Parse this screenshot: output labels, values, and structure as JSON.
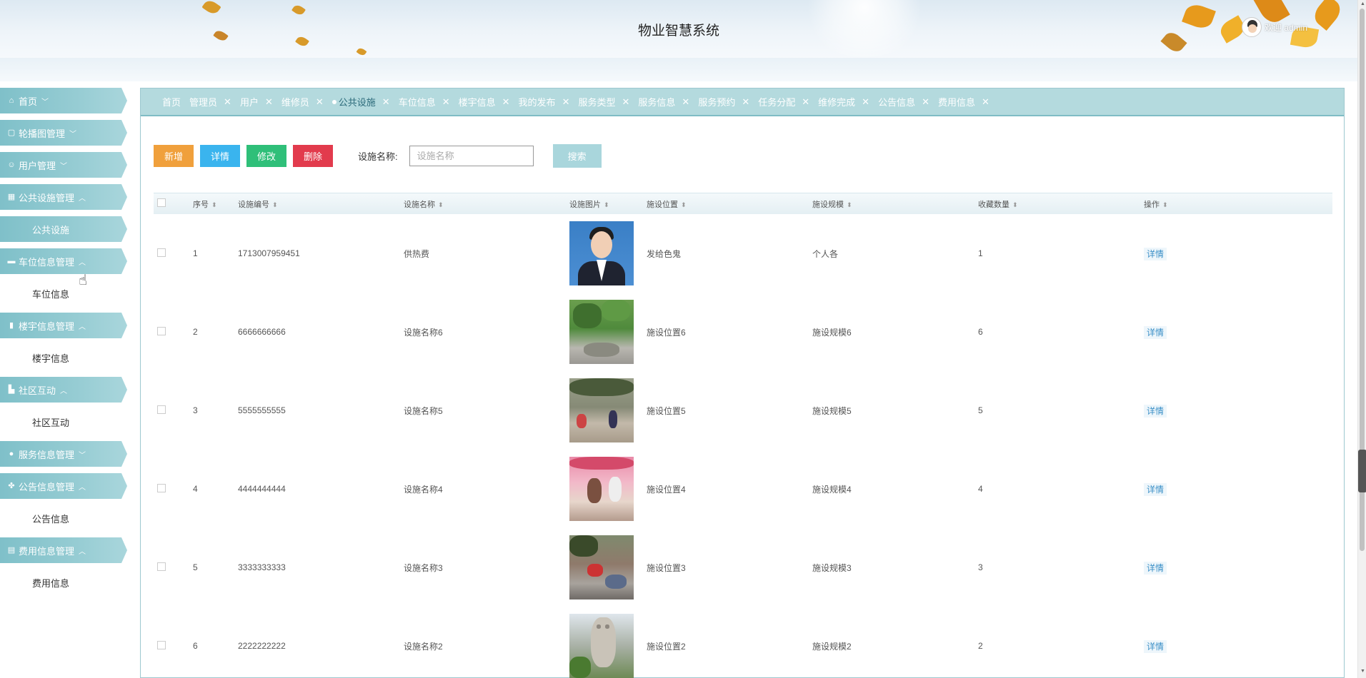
{
  "header": {
    "title": "物业智慧系统",
    "welcome": "欢迎 admin"
  },
  "sidebar": {
    "items": [
      {
        "label": "首页",
        "icon": "home-icon",
        "glyph": "⌂",
        "chevron": "﹀",
        "active": false
      },
      {
        "label": "轮播图管理",
        "icon": "image-icon",
        "glyph": "▢",
        "chevron": "﹀",
        "active": false
      },
      {
        "label": "用户管理",
        "icon": "user-icon",
        "glyph": "☺",
        "chevron": "﹀",
        "active": false
      },
      {
        "label": "公共设施管理",
        "icon": "grid-icon",
        "glyph": "▦",
        "chevron": "︿",
        "active": false,
        "sub": "公共设施",
        "subActive": true
      },
      {
        "label": "车位信息管理",
        "icon": "car-icon",
        "glyph": "▬",
        "chevron": "︿",
        "active": false,
        "sub": "车位信息",
        "subActive": false
      },
      {
        "label": "楼宇信息管理",
        "icon": "building-icon",
        "glyph": "▮",
        "chevron": "︿",
        "active": false,
        "sub": "楼宇信息",
        "subActive": false
      },
      {
        "label": "社区互动",
        "icon": "community-icon",
        "glyph": "▙",
        "chevron": "︿",
        "active": false,
        "sub": "社区互动",
        "subActive": false
      },
      {
        "label": "服务信息管理",
        "icon": "service-icon",
        "glyph": "●",
        "chevron": "﹀",
        "active": false
      },
      {
        "label": "公告信息管理",
        "icon": "apps-icon",
        "glyph": "✤",
        "chevron": "︿",
        "active": false,
        "sub": "公告信息",
        "subActive": false
      },
      {
        "label": "费用信息管理",
        "icon": "fee-icon",
        "glyph": "▤",
        "chevron": "︿",
        "active": false,
        "sub": "费用信息",
        "subActive": false
      }
    ]
  },
  "tabs": [
    {
      "label": "首页",
      "closable": false,
      "active": false
    },
    {
      "label": "管理员",
      "closable": true,
      "active": false
    },
    {
      "label": "用户",
      "closable": true,
      "active": false
    },
    {
      "label": "维修员",
      "closable": true,
      "active": false
    },
    {
      "label": "公共设施",
      "closable": true,
      "active": true
    },
    {
      "label": "车位信息",
      "closable": true,
      "active": false
    },
    {
      "label": "楼宇信息",
      "closable": true,
      "active": false
    },
    {
      "label": "我的发布",
      "closable": true,
      "active": false
    },
    {
      "label": "服务类型",
      "closable": true,
      "active": false
    },
    {
      "label": "服务信息",
      "closable": true,
      "active": false
    },
    {
      "label": "服务预约",
      "closable": true,
      "active": false
    },
    {
      "label": "任务分配",
      "closable": true,
      "active": false
    },
    {
      "label": "维修完成",
      "closable": true,
      "active": false
    },
    {
      "label": "公告信息",
      "closable": true,
      "active": false
    },
    {
      "label": "费用信息",
      "closable": true,
      "active": false
    }
  ],
  "toolbar": {
    "add_label": "新增",
    "detail_label": "详情",
    "edit_label": "修改",
    "delete_label": "删除",
    "search_label": "设施名称:",
    "search_placeholder": "设施名称",
    "search_button": "搜索"
  },
  "table": {
    "columns": [
      "序号",
      "设施编号",
      "设施名称",
      "设施图片",
      "施设位置",
      "施设规模",
      "收藏数量",
      "操作"
    ],
    "action_label": "详情",
    "rows": [
      {
        "index": "1",
        "code": "1713007959451",
        "name": "供热费",
        "image": "portrait",
        "location": "发给色鬼",
        "scale": "个人各",
        "favorites": "1"
      },
      {
        "index": "2",
        "code": "6666666666",
        "name": "设施名称6",
        "image": "park",
        "location": "施设位置6",
        "scale": "施设规模6",
        "favorites": "6"
      },
      {
        "index": "3",
        "code": "5555555555",
        "name": "设施名称5",
        "image": "street",
        "location": "施设位置5",
        "scale": "施设规模5",
        "favorites": "5"
      },
      {
        "index": "4",
        "code": "4444444444",
        "name": "设施名称4",
        "image": "indoor",
        "location": "施设位置4",
        "scale": "施设规模4",
        "favorites": "4"
      },
      {
        "index": "5",
        "code": "3333333333",
        "name": "设施名称3",
        "image": "outdoor",
        "location": "施设位置3",
        "scale": "施设规模3",
        "favorites": "3"
      },
      {
        "index": "6",
        "code": "2222222222",
        "name": "设施名称2",
        "image": "building",
        "location": "施设位置2",
        "scale": "施设规模2",
        "favorites": "2"
      }
    ]
  },
  "colors": {
    "accent": "#96ccd3",
    "tabbar": "#b4dade",
    "add": "#f0a03c",
    "detail": "#3ab4ee",
    "edit": "#2fbf79",
    "delete": "#e23b4d"
  }
}
